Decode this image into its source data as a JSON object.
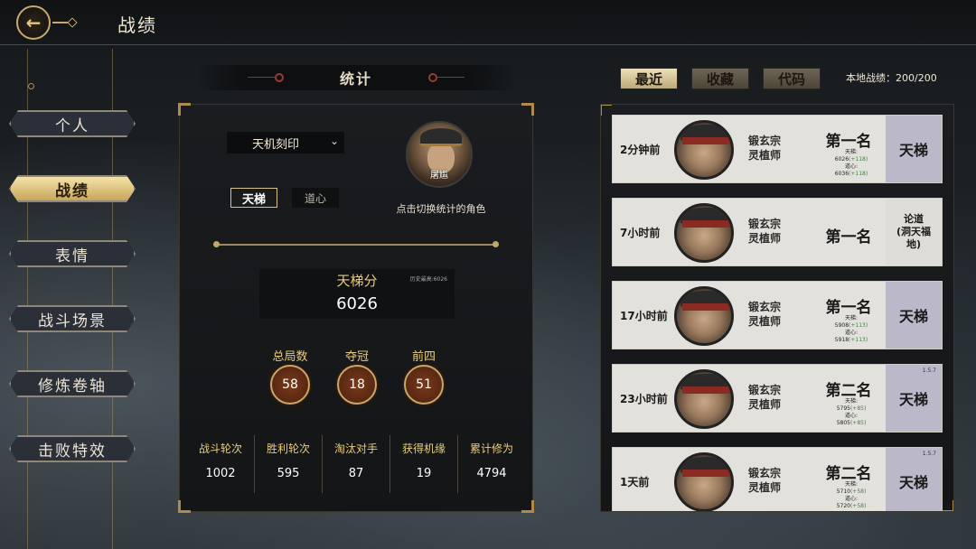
{
  "header": {
    "title": "战绩",
    "back_icon": "back-arrow-icon"
  },
  "menu": [
    {
      "label": "个人",
      "active": false
    },
    {
      "label": "战绩",
      "active": true
    },
    {
      "label": "表情",
      "active": false
    },
    {
      "label": "战斗场景",
      "active": false
    },
    {
      "label": "修炼卷轴",
      "active": false
    },
    {
      "label": "击败特效",
      "active": false
    }
  ],
  "stats": {
    "title": "统计",
    "select_value": "天机刻印",
    "character_name": "屠尴",
    "switch_hint": "点击切换统计的角色",
    "tabs": {
      "ladder": "天梯",
      "heart": "道心"
    },
    "score_label": "天梯分",
    "score_history": "历史最高:6026",
    "score_value": "6026",
    "badges": [
      {
        "label": "总局数",
        "value": "58"
      },
      {
        "label": "夺冠",
        "value": "18"
      },
      {
        "label": "前四",
        "value": "51"
      }
    ],
    "columns": [
      {
        "label": "战斗轮次",
        "value": "1002"
      },
      {
        "label": "胜利轮次",
        "value": "595"
      },
      {
        "label": "淘汰对手",
        "value": "87"
      },
      {
        "label": "获得机缘",
        "value": "19"
      },
      {
        "label": "累计修为",
        "value": "4794"
      }
    ]
  },
  "right_tabs": {
    "recent": "最近",
    "favorites": "收藏",
    "code": "代码"
  },
  "local_count": "本地战绩：200/200",
  "records": [
    {
      "time": "2分钟前",
      "sect": "锻玄宗",
      "role": "灵植师",
      "rank": "第一名",
      "ladder_label": "天梯:",
      "ladder_value": "6026",
      "ladder_delta": "(+118)",
      "heart_label": "道心:",
      "heart_value": "6036",
      "heart_delta": "(+118)",
      "mode": "天梯",
      "version": ""
    },
    {
      "time": "7小时前",
      "sect": "锻玄宗",
      "role": "灵植师",
      "rank": "第一名",
      "ladder_label": "",
      "ladder_value": "",
      "ladder_delta": "",
      "heart_label": "",
      "heart_value": "",
      "heart_delta": "",
      "mode": "论道\n(洞天福地)",
      "version": ""
    },
    {
      "time": "17小时前",
      "sect": "锻玄宗",
      "role": "灵植师",
      "rank": "第一名",
      "ladder_label": "天梯:",
      "ladder_value": "5908",
      "ladder_delta": "(+113)",
      "heart_label": "道心:",
      "heart_value": "5918",
      "heart_delta": "(+113)",
      "mode": "天梯",
      "version": ""
    },
    {
      "time": "23小时前",
      "sect": "锻玄宗",
      "role": "灵植师",
      "rank": "第二名",
      "ladder_label": "天梯:",
      "ladder_value": "5795",
      "ladder_delta": "(+85)",
      "heart_label": "道心:",
      "heart_value": "5805",
      "heart_delta": "(+85)",
      "mode": "天梯",
      "version": "1.5.7"
    },
    {
      "time": "1天前",
      "sect": "锻玄宗",
      "role": "灵植师",
      "rank": "第二名",
      "ladder_label": "天梯:",
      "ladder_value": "5710",
      "ladder_delta": "(+58)",
      "heart_label": "道心:",
      "heart_value": "5720",
      "heart_delta": "(+58)",
      "mode": "天梯",
      "version": "1.5.7"
    }
  ]
}
